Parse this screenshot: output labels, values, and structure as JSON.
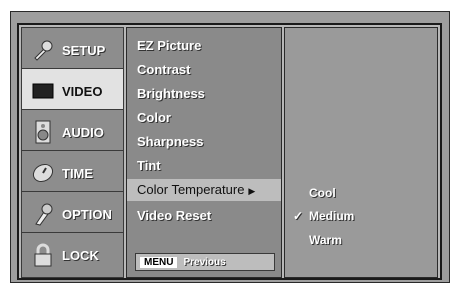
{
  "sidebar": {
    "items": [
      {
        "label": "SETUP",
        "icon": "wrench-icon"
      },
      {
        "label": "VIDEO",
        "icon": "screen-icon"
      },
      {
        "label": "AUDIO",
        "icon": "speaker-icon"
      },
      {
        "label": "TIME",
        "icon": "clock-icon"
      },
      {
        "label": "OPTION",
        "icon": "gear-icon"
      },
      {
        "label": "LOCK",
        "icon": "lock-icon"
      }
    ],
    "active": "VIDEO"
  },
  "menu": {
    "items": [
      "EZ Picture",
      "Contrast",
      "Brightness",
      "Color",
      "Sharpness",
      "Tint",
      "Color Temperature",
      "Video Reset"
    ],
    "selected": "Color Temperature",
    "selected_arrow": "▶",
    "footer_key": "MENU",
    "footer_label": "Previous"
  },
  "submenu": {
    "options": [
      "Cool",
      "Medium",
      "Warm"
    ],
    "checked": "Medium",
    "check_glyph": "✓"
  }
}
